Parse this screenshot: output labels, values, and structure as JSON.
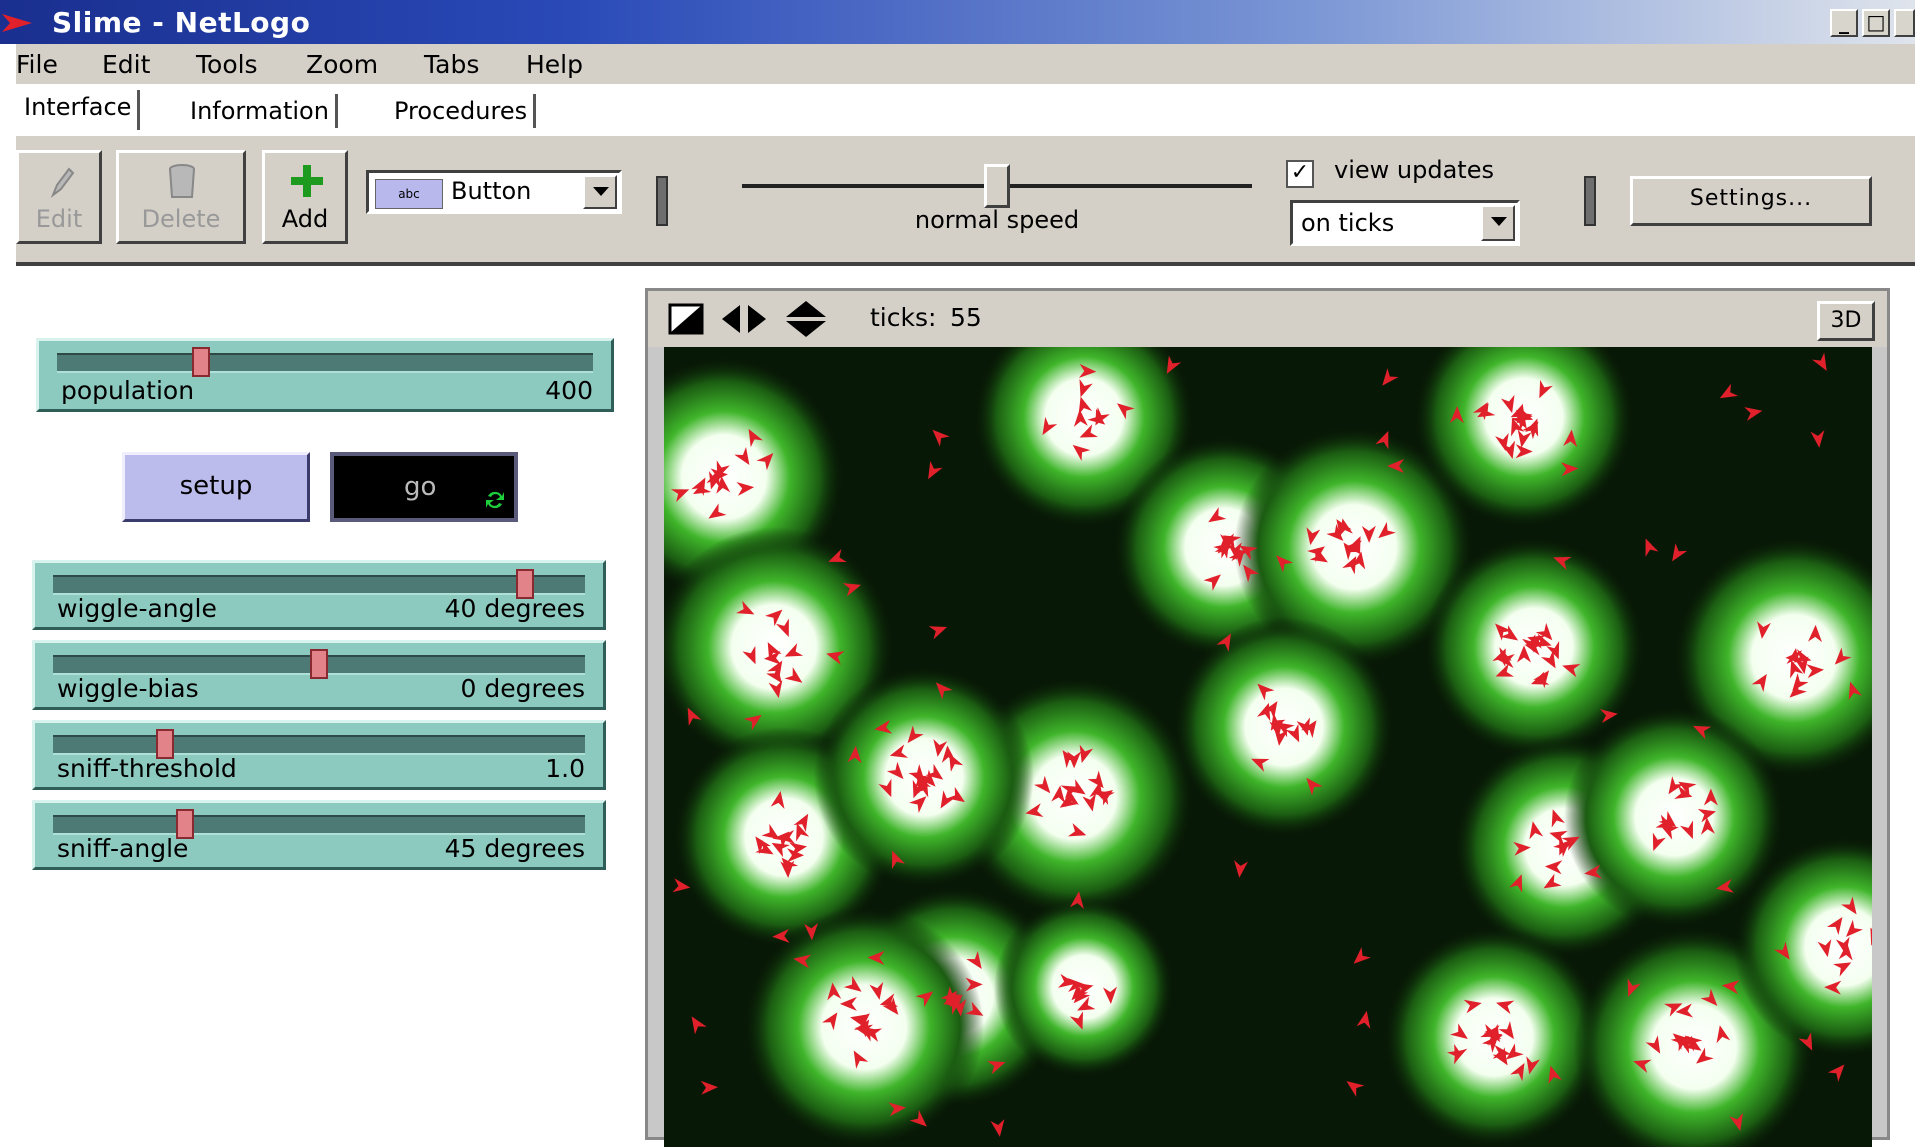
{
  "window": {
    "title": "Slime - NetLogo",
    "min": "_",
    "max": "□"
  },
  "menu": [
    "File",
    "Edit",
    "Tools",
    "Zoom",
    "Tabs",
    "Help"
  ],
  "tabs": [
    "Interface",
    "Information",
    "Procedures"
  ],
  "toolbar": {
    "edit": "Edit",
    "delete": "Delete",
    "add": "Add",
    "widget_type": "Button",
    "widget_type_icon_text": "abc",
    "speed_label": "normal speed",
    "speed_fraction": 0.5,
    "view_updates_label": "view updates",
    "view_updates_checked": true,
    "update_mode": "on ticks",
    "settings": "Settings..."
  },
  "widgets": {
    "population": {
      "name": "population",
      "value": "400",
      "fraction": 0.26
    },
    "setup_label": "setup",
    "go_label": "go",
    "wiggle_angle": {
      "name": "wiggle-angle",
      "value": "40 degrees",
      "fraction": 0.9
    },
    "wiggle_bias": {
      "name": "wiggle-bias",
      "value": "0 degrees",
      "fraction": 0.5
    },
    "sniff_threshold": {
      "name": "sniff-threshold",
      "value": "1.0",
      "fraction": 0.2
    },
    "sniff_angle": {
      "name": "sniff-angle",
      "value": "45 degrees",
      "fraction": 0.24
    }
  },
  "view": {
    "ticks_label": "ticks:",
    "ticks": "55",
    "three_d": "3D"
  },
  "colors": {
    "slider_bg": "#8cc9bf",
    "setup_bg": "#bcbcec",
    "patch_green": "#2d8a1e",
    "turtle_red": "#e0202a"
  }
}
